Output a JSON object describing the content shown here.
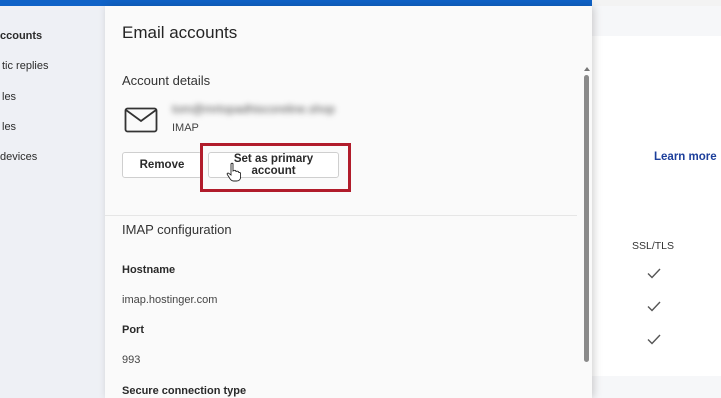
{
  "sidebar": {
    "items": [
      {
        "label": "ccounts",
        "active": true
      },
      {
        "label": "tic replies",
        "active": false
      },
      {
        "label": "les",
        "active": false
      },
      {
        "label": "les",
        "active": false
      },
      {
        "label": "devices",
        "active": false
      }
    ]
  },
  "panel": {
    "title": "Email accounts",
    "account_details_label": "Account details",
    "email_blurred": "tom@mrtopadhiscoreline.shop",
    "protocol": "IMAP",
    "remove_label": "Remove",
    "set_primary_label": "Set as primary account",
    "imap_title": "IMAP configuration",
    "hostname_label": "Hostname",
    "hostname_value": "imap.hostinger.com",
    "port_label": "Port",
    "port_value": "993",
    "secure_label": "Secure connection type"
  },
  "background": {
    "learn_more": "Learn more",
    "ssl_header": "SSL/TLS"
  },
  "colors": {
    "accent": "#0f62c7",
    "highlight": "#b11c2b",
    "link": "#1d3f9b"
  }
}
